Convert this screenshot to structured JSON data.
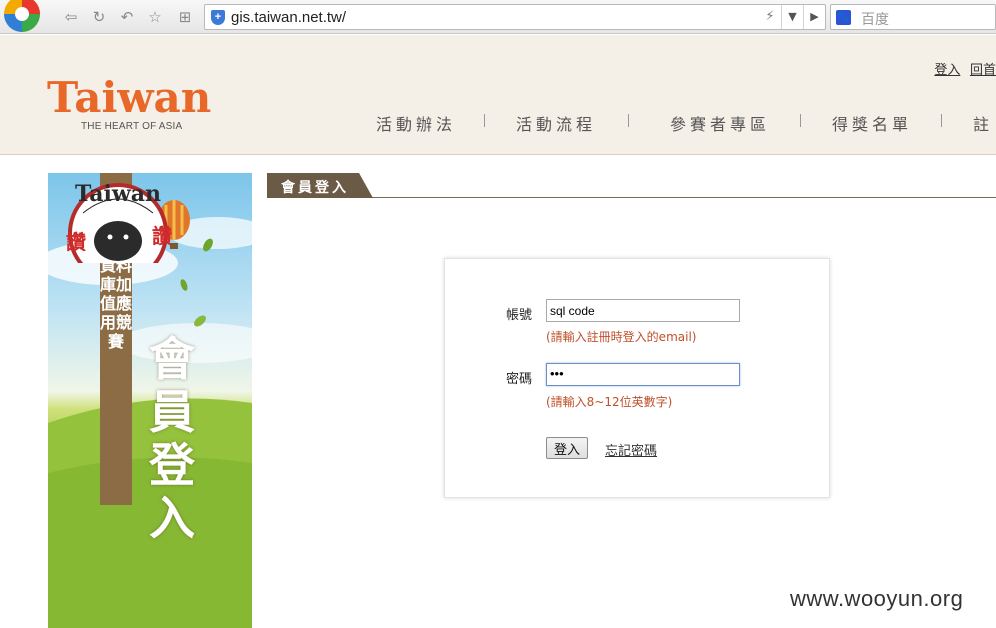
{
  "browser": {
    "url": "gis.taiwan.net.tw/",
    "search_placeholder": "百度"
  },
  "header": {
    "logo_text": "Taiwan",
    "logo_tagline": "THE HEART OF ASIA",
    "top_links": [
      "登入",
      "回首"
    ],
    "nav": [
      "活動辦法",
      "活動流程",
      "參賽者專區",
      "得獎名單",
      "註"
    ]
  },
  "banner": {
    "strip_text": "臺灣觀光資訊資料庫加值應用競賽",
    "title": "會員登入",
    "badge_text": "Taiwan",
    "badge_chars": [
      "讚",
      "讚"
    ]
  },
  "section": {
    "tab_label": "會員登入"
  },
  "login": {
    "account_label": "帳號",
    "account_value": "sql code",
    "account_hint": "(請輸入註冊時登入的email)",
    "password_label": "密碼",
    "password_value": "•••",
    "password_hint": "(請輸入8~12位英數字)",
    "submit_label": "登入",
    "forgot_label": "忘記密碼"
  },
  "watermark": "www.wooyun.org",
  "colors": {
    "logo_orange": "#e8682a",
    "nav_text": "#555555",
    "tab_bg": "#6b5a45",
    "hint": "#c0502a",
    "header_bg": "#f4efe7"
  }
}
